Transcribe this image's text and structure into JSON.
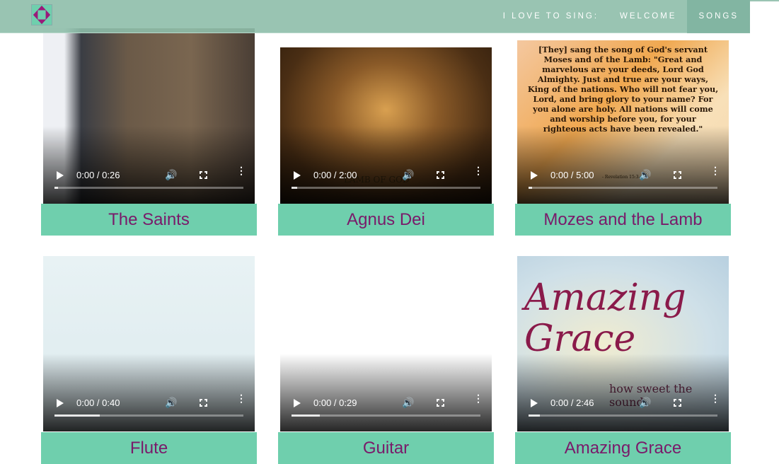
{
  "header": {
    "nav": [
      "I LOVE TO SING:",
      "WELCOME",
      "SONGS"
    ],
    "active": "SONGS"
  },
  "colors": {
    "header": "#9ac4b3",
    "label_bg": "#6fcfad",
    "label_text": "#7a1a6a"
  },
  "songs": [
    {
      "title": "The Saints",
      "time": "0:00 / 0:26",
      "buffered": 0.02
    },
    {
      "title": "Agnus Dei",
      "time": "0:00 / 2:00",
      "buffered": 0.03,
      "overlay": "LAMB OF GOD"
    },
    {
      "title": "Mozes and the Lamb",
      "time": "0:00 / 5:00",
      "buffered": 0.02,
      "overlay": "[They] sang the song of God's servant Moses and of the Lamb: \"Great and marvelous are your deeds, Lord God Almighty. Just and true are your ways, King of the nations. Who will not fear you, Lord, and bring glory to your name? For you alone are holy. All nations will come and worship before you, for your righteous acts have been revealed.\"",
      "ref": "- Revelation 15:3-4 -"
    },
    {
      "title": "Flute",
      "time": "0:00 / 0:40",
      "buffered": 0.24
    },
    {
      "title": "Guitar",
      "time": "0:00 / 0:29",
      "buffered": 0.15
    },
    {
      "title": "Amazing Grace",
      "time": "0:00 / 2:46",
      "buffered": 0.06,
      "overlay": "Amazing Grace",
      "overlay2": "how sweet the sound"
    }
  ]
}
